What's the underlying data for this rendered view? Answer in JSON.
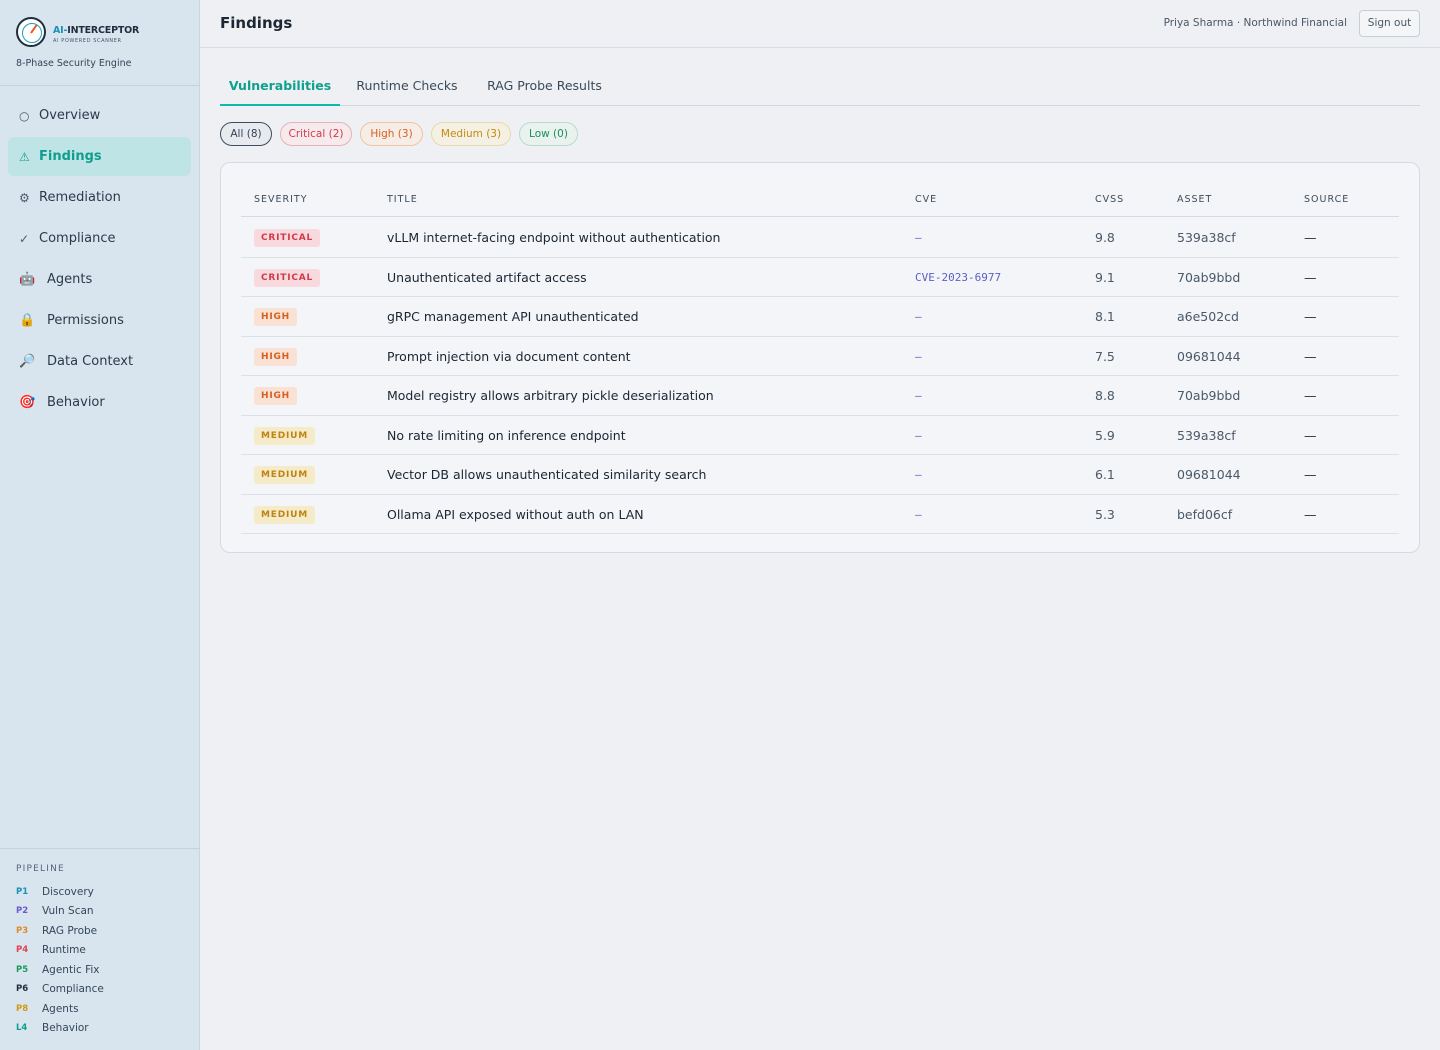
{
  "app": {
    "brand_prefix": "AI-",
    "brand_name": "INTERCEPTOR",
    "brand_sub": "AI POWERED SCANNER",
    "tagline": "8-Phase Security Engine"
  },
  "sidebar": {
    "items": [
      {
        "label": "Overview",
        "icon": "○",
        "icon_name": "hexagon-icon"
      },
      {
        "label": "Findings",
        "icon": "⚠",
        "icon_name": "warning-icon",
        "active": true
      },
      {
        "label": "Remediation",
        "icon": "⚙",
        "icon_name": "gear-icon"
      },
      {
        "label": "Compliance",
        "icon": "✓",
        "icon_name": "check-icon"
      },
      {
        "label": "Agents",
        "icon": "🤖",
        "icon_name": "robot-icon"
      },
      {
        "label": "Permissions",
        "icon": "🔒",
        "icon_name": "lock-icon"
      },
      {
        "label": "Data Context",
        "icon": "🔎",
        "icon_name": "magnifier-icon"
      },
      {
        "label": "Behavior",
        "icon": "🎯",
        "icon_name": "target-icon"
      }
    ]
  },
  "pipeline": {
    "title": "PIPELINE",
    "phases": [
      {
        "code": "P1",
        "label": "Discovery",
        "color": "#1c8fb5"
      },
      {
        "code": "P2",
        "label": "Vuln Scan",
        "color": "#6a5acd"
      },
      {
        "code": "P3",
        "label": "RAG Probe",
        "color": "#e08a2a"
      },
      {
        "code": "P4",
        "label": "Runtime",
        "color": "#e0424f"
      },
      {
        "code": "P5",
        "label": "Agentic Fix",
        "color": "#1f9a5a"
      },
      {
        "code": "P6",
        "label": "Compliance",
        "color": "#1f2d3d"
      },
      {
        "code": "P8",
        "label": "Agents",
        "color": "#d29a12"
      },
      {
        "code": "L4",
        "label": "Behavior",
        "color": "#0f9e8f"
      }
    ]
  },
  "header": {
    "title": "Findings",
    "user": "Priya Sharma · Northwind Financial",
    "signout_label": "Sign out"
  },
  "tabs": [
    {
      "label": "Vulnerabilities",
      "active": true
    },
    {
      "label": "Runtime Checks"
    },
    {
      "label": "RAG Probe Results"
    }
  ],
  "filters": [
    {
      "label": "All (8)",
      "kind": "all"
    },
    {
      "label": "Critical (2)",
      "kind": "crit"
    },
    {
      "label": "High (3)",
      "kind": "high"
    },
    {
      "label": "Medium (3)",
      "kind": "med"
    },
    {
      "label": "Low (0)",
      "kind": "low"
    }
  ],
  "table": {
    "columns": [
      "SEVERITY",
      "TITLE",
      "CVE",
      "CVSS",
      "ASSET",
      "SOURCE"
    ],
    "rows": [
      {
        "severity": "CRITICAL",
        "title": "vLLM internet-facing endpoint without authentication",
        "cve": "–",
        "cvss": "9.8",
        "asset": "539a38cf",
        "source": "—"
      },
      {
        "severity": "CRITICAL",
        "title": "Unauthenticated artifact access",
        "cve": "CVE-2023-6977",
        "cvss": "9.1",
        "asset": "70ab9bbd",
        "source": "—"
      },
      {
        "severity": "HIGH",
        "title": "gRPC management API unauthenticated",
        "cve": "–",
        "cvss": "8.1",
        "asset": "a6e502cd",
        "source": "—"
      },
      {
        "severity": "HIGH",
        "title": "Prompt injection via document content",
        "cve": "–",
        "cvss": "7.5",
        "asset": "09681044",
        "source": "—"
      },
      {
        "severity": "HIGH",
        "title": "Model registry allows arbitrary pickle deserialization",
        "cve": "–",
        "cvss": "8.8",
        "asset": "70ab9bbd",
        "source": "—"
      },
      {
        "severity": "MEDIUM",
        "title": "No rate limiting on inference endpoint",
        "cve": "–",
        "cvss": "5.9",
        "asset": "539a38cf",
        "source": "—"
      },
      {
        "severity": "MEDIUM",
        "title": "Vector DB allows unauthenticated similarity search",
        "cve": "–",
        "cvss": "6.1",
        "asset": "09681044",
        "source": "—"
      },
      {
        "severity": "MEDIUM",
        "title": "Ollama API exposed without auth on LAN",
        "cve": "–",
        "cvss": "5.3",
        "asset": "befd06cf",
        "source": "—"
      }
    ]
  }
}
